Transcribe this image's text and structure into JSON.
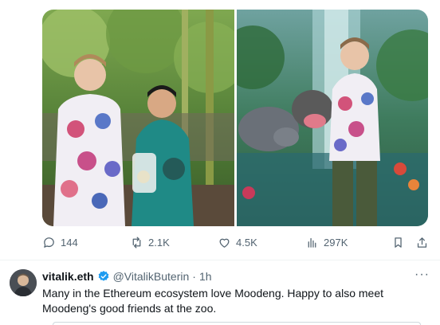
{
  "media": {
    "left_photo_icon": "photo-zoo-visit",
    "right_photo_icon": "photo-jungle-mural"
  },
  "actions": {
    "replies": "144",
    "reposts": "2.1K",
    "likes": "4.5K",
    "views": "297K"
  },
  "tweet": {
    "name": "vitalik.eth",
    "handle": "@VitalikButerin",
    "separator": "·",
    "time": "1h",
    "text": "Many in the Ethereum ecosystem love Moodeng. Happy to also meet Moodeng's good friends at the zoo.",
    "more": "···"
  },
  "colors": {
    "muted": "#536471",
    "verified": "#1d9bf0",
    "text": "#0f1419"
  }
}
